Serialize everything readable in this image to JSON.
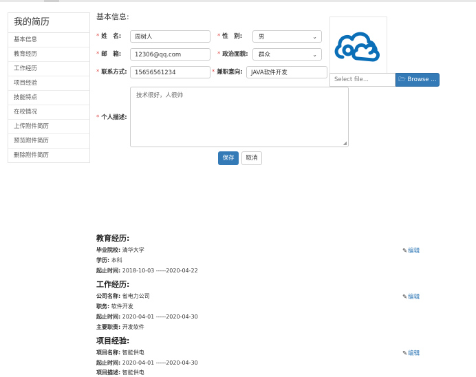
{
  "sidebar": {
    "title": "我的简历",
    "items": [
      "基本信息",
      "教育经历",
      "工作经历",
      "项目经验",
      "技能特点",
      "在校情况",
      "上传附件简历",
      "预览附件简历",
      "删除附件简历"
    ]
  },
  "basic": {
    "section_title": "基本信息:",
    "name_label": "姓　名:",
    "name_value": "周树人",
    "gender_label": "性　别:",
    "gender_value": "男",
    "email_label": "邮　箱:",
    "email_value": "12306@qq.com",
    "political_label": "政治面貌:",
    "political_value": "群众",
    "phone_label": "联系方式:",
    "phone_value": "15656561234",
    "job_label": "兼职意向:",
    "job_value": "JAVA软件开发",
    "desc_label": "个人描述:",
    "desc_value": "技术很好，人很帅",
    "required_mark": "*",
    "file_placeholder": "Select file...",
    "browse_label": "Browse …",
    "save_label": "保存",
    "cancel_label": "取消"
  },
  "education": {
    "title": "教育经历:",
    "school_label": "毕业院校:",
    "school_value": "清华大学",
    "degree_label": "学历:",
    "degree_value": "本科",
    "period_label": "起止时间:",
    "period_value": "2018-10-03 -----2020-04-22",
    "edit_label": "编辑"
  },
  "work": {
    "title": "工作经历:",
    "company_label": "公司名称:",
    "company_value": "省电力公司",
    "position_label": "职务:",
    "position_value": "软件开发",
    "period_label": "起止时间:",
    "period_value": "2020-04-01 -----2020-04-30",
    "duty_label": "主要职责:",
    "duty_value": "开发软件",
    "edit_label": "编辑"
  },
  "project": {
    "title": "项目经验:",
    "name_label": "项目名称:",
    "name_value": "智能供电",
    "period_label": "起止时间:",
    "period_value": "2020-04-01 -----2020-04-30",
    "desc_label": "项目描述:",
    "desc_value": "智能供电",
    "edit_label": "编辑"
  },
  "colors": {
    "primary": "#337ab7",
    "required": "#e05050",
    "logo": "#0b6fb8"
  },
  "icons": {
    "edit": "edit-icon",
    "folder": "folder-open-icon",
    "logo": "cloud-logo-icon",
    "chevron": "chevron-down-icon"
  }
}
